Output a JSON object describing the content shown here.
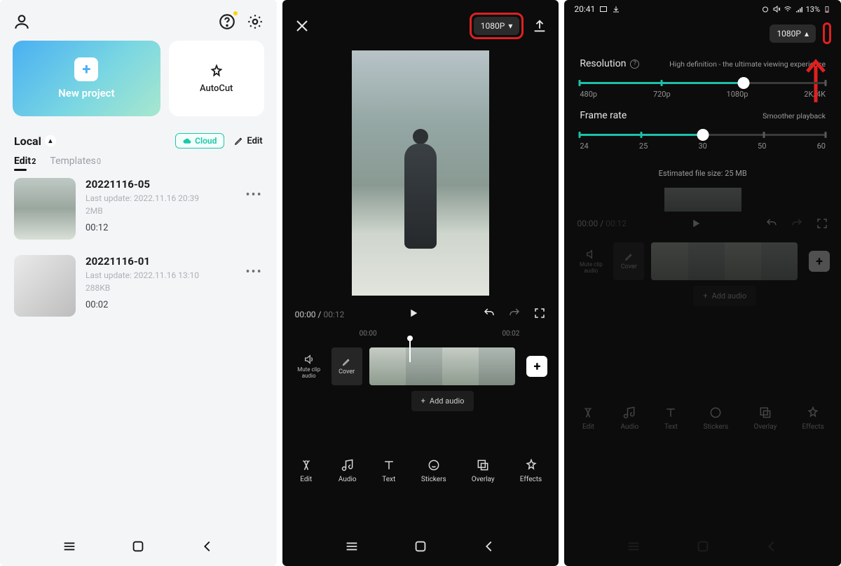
{
  "screen1": {
    "new_project": "New project",
    "autocut": "AutoCut",
    "section_title": "Local",
    "cloud_label": "Cloud",
    "edit_label": "Edit",
    "tabs": {
      "edit": "Edit",
      "edit_count": "2",
      "templates": "Templates",
      "templates_count": "0"
    },
    "projects": [
      {
        "title": "20221116-05",
        "updated": "Last update: 2022.11.16 20:39",
        "size": "2MB",
        "duration": "00:12"
      },
      {
        "title": "20221116-01",
        "updated": "Last update: 2022.11.16 13:10",
        "size": "288KB",
        "duration": "00:02"
      }
    ]
  },
  "screen2": {
    "resolution_btn": "1080P",
    "time_current": "00:00",
    "time_total": "00:12",
    "ruler": [
      "00:00",
      "00:02"
    ],
    "mute_label": "Mute clip audio",
    "cover_label": "Cover",
    "add_audio": "Add audio",
    "tools": [
      "Edit",
      "Audio",
      "Text",
      "Stickers",
      "Overlay",
      "Effects"
    ]
  },
  "screen3": {
    "status_time": "20:41",
    "battery": "13%",
    "resolution_btn": "1080P",
    "res_title": "Resolution",
    "res_desc": "High definition - the ultimate viewing experience",
    "res_marks": [
      "480p",
      "720p",
      "1080p",
      "2K/4K"
    ],
    "fr_title": "Frame rate",
    "fr_desc": "Smoother playback",
    "fr_marks": [
      "24",
      "25",
      "30",
      "50",
      "60"
    ],
    "est_size": "Estimated file size: 25 MB",
    "time_current": "00:00",
    "time_total": "00:12",
    "mute_label": "Mute clip audio",
    "cover_label": "Cover",
    "add_audio": "Add audio",
    "tools": [
      "Edit",
      "Audio",
      "Text",
      "Stickers",
      "Overlay",
      "Effects"
    ]
  },
  "nav": {
    "recents": "☰",
    "home": "○",
    "back": "‹"
  }
}
